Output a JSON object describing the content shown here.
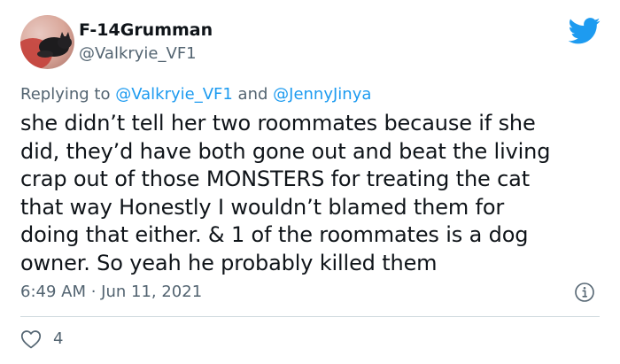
{
  "author": {
    "display_name": "F-14Grumman",
    "handle": "@Valkryie_VF1"
  },
  "reply": {
    "prefix": "Replying to ",
    "mention_1": "@Valkryie_VF1",
    "conjunction": " and ",
    "mention_2": "@JennyJinya"
  },
  "tweet": {
    "lines": [
      "she didn’t tell her two roommates because if she",
      "did, they’d have both gone out and beat the living",
      "crap out of those MONSTERS for treating the cat",
      "that way Honestly I wouldn’t blamed them for",
      "doing that either. & 1 of the roommates is a dog",
      "owner. So yeah he probably killed them"
    ],
    "timestamp": "6:49 AM · Jun 11, 2021",
    "like_count": "4"
  },
  "icons": {
    "brand": "twitter-bird-icon",
    "info": "info-icon",
    "like": "heart-icon"
  },
  "colors": {
    "accent": "#1d9bf0",
    "text": "#0f1419",
    "secondary": "#536471",
    "divider": "#cfd9de"
  }
}
